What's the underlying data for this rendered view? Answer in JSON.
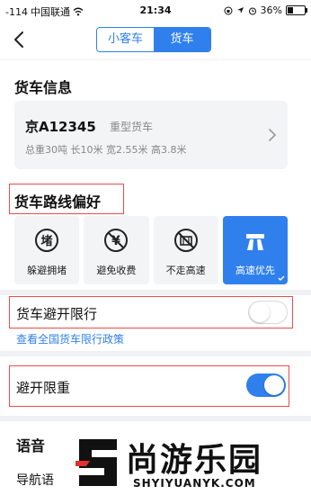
{
  "status_bar": {
    "signal": "-114",
    "carrier": "中国联通",
    "time": "21:34",
    "battery": "36%",
    "battery_level": 0.36
  },
  "nav": {
    "tab_car": "小客车",
    "tab_truck": "货车",
    "active_tab": "货车"
  },
  "truck_info": {
    "title": "货车信息",
    "plate": "京A12345",
    "type": "重型货车",
    "spec": "总重30吨 长10米 宽2.55米 高3.8米"
  },
  "route_pref": {
    "title": "货车路线偏好",
    "options": [
      {
        "label": "躲避拥堵",
        "icon": "congestion-icon",
        "selected": false
      },
      {
        "label": "避免收费",
        "icon": "yuan-no-toll-icon",
        "selected": false
      },
      {
        "label": "不走高速",
        "icon": "no-highway-icon",
        "selected": false
      },
      {
        "label": "高速优先",
        "icon": "highway-icon",
        "selected": true
      }
    ]
  },
  "restriction": {
    "label": "货车避开限行",
    "enabled": false,
    "policy_link": "查看全国货车限行政策"
  },
  "weight_limit": {
    "label": "避开限重",
    "enabled": true
  },
  "voice": {
    "title": "语音",
    "nav_voice_label": "导航语"
  },
  "watermark": {
    "text": "尚游乐园",
    "url": "SHYIYUANYK.COM"
  },
  "colors": {
    "accent": "#2f80ed",
    "highlight_box": "#e84c4c",
    "card_bg": "#f3f4f6"
  }
}
